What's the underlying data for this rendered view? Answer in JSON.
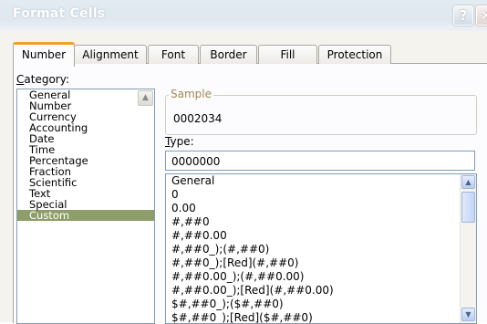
{
  "window": {
    "title": "Format Cells",
    "help_glyph": "?",
    "close_glyph": "✕"
  },
  "tabs": [
    {
      "label": "Number",
      "active": true
    },
    {
      "label": "Alignment",
      "active": false
    },
    {
      "label": "Font",
      "active": false
    },
    {
      "label": "Border",
      "active": false
    },
    {
      "label": "Fill",
      "active": false
    },
    {
      "label": "Protection",
      "active": false
    }
  ],
  "category": {
    "label_underlined": "C",
    "label_rest": "ategory:",
    "items": [
      "General",
      "Number",
      "Currency",
      "Accounting",
      "Date",
      "Time",
      "Percentage",
      "Fraction",
      "Scientific",
      "Text",
      "Special",
      "Custom"
    ],
    "selected": "Custom"
  },
  "sample": {
    "legend": "Sample",
    "value": "0002034"
  },
  "type": {
    "label_underlined": "T",
    "label_rest": "ype:",
    "value": "0000000",
    "formats": [
      "General",
      "0",
      "0.00",
      "#,##0",
      "#,##0.00",
      "#,##0_);(#,##0)",
      "#,##0_);[Red](#,##0)",
      "#,##0.00_);(#,##0.00)",
      "#,##0.00_);[Red](#,##0.00)",
      "$#,##0_);($#,##0)",
      "$#,##0_);[Red]($#,##0)"
    ]
  },
  "colors": {
    "accent_tab": "#f0a12a",
    "selection": "#8d9e6a",
    "sample_legend": "#a08a56"
  },
  "icons": {
    "scroll_up": "scroll-up-icon",
    "scroll_down": "scroll-down-icon"
  }
}
